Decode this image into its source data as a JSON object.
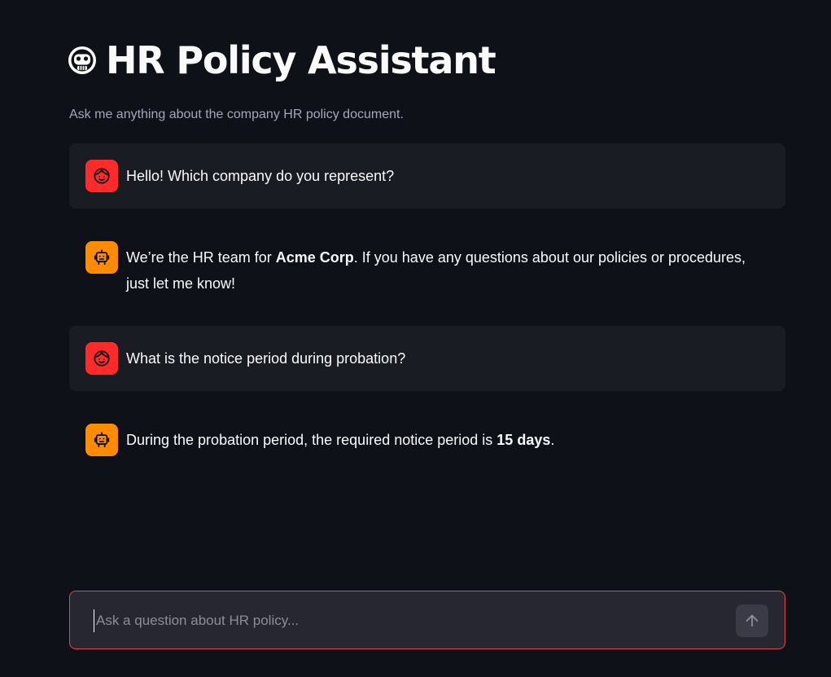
{
  "header": {
    "title": "HR Policy Assistant",
    "title_icon": "robot-face-icon",
    "subtitle": "Ask me anything about the company HR policy document."
  },
  "messages": [
    {
      "role": "user",
      "icon": "user-face-icon",
      "parts": [
        {
          "text": "Hello! Which company do you represent?",
          "bold": false
        }
      ]
    },
    {
      "role": "assistant",
      "icon": "bot-icon",
      "parts": [
        {
          "text": "We’re the HR team for ",
          "bold": false
        },
        {
          "text": "Acme Corp",
          "bold": true
        },
        {
          "text": ". If you have any questions about our policies or procedures, just let me know!",
          "bold": false
        }
      ]
    },
    {
      "role": "user",
      "icon": "user-face-icon",
      "parts": [
        {
          "text": "What is the notice period during probation?",
          "bold": false
        }
      ]
    },
    {
      "role": "assistant",
      "icon": "bot-icon",
      "parts": [
        {
          "text": "During the probation period, the required notice period is ",
          "bold": false
        },
        {
          "text": "15 days",
          "bold": true
        },
        {
          "text": ".",
          "bold": false
        }
      ]
    }
  ],
  "chat_input": {
    "value": "",
    "placeholder": "Ask a question about HR policy...",
    "send_icon": "arrow-up-icon"
  },
  "colors": {
    "background": "#0e1117",
    "user_message_bg": "#1a1c24",
    "user_avatar": "#ff2b2b",
    "bot_avatar": "#ff8c00",
    "input_border": "#e0474c"
  }
}
